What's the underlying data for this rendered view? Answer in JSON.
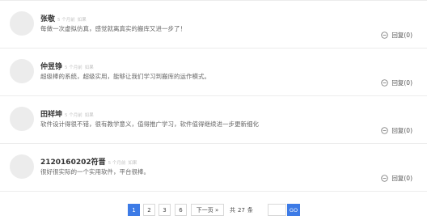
{
  "comments": [
    {
      "name": "张敬",
      "time": "5 个月前",
      "tag": "如果",
      "text": "每做一次虚拟仿真，感觉就离真实的搬库又进一步了！",
      "reply_label": "回复(0)"
    },
    {
      "name": "仲昱铮",
      "time": "5 个月前",
      "tag": "如果",
      "text": "超级棒的系统，超级实用，能够让我们学习到搬库的运作模式。",
      "reply_label": "回复(0)"
    },
    {
      "name": "田祥坤",
      "time": "5 个月前",
      "tag": "如果",
      "text": "软件设计得很不错，很有教学意义，值得推广学习，软件值得继续进一步更新细化",
      "reply_label": "回复(0)"
    },
    {
      "name": "2120160202符晋",
      "time": "5 个月前",
      "tag": "如果",
      "text": "很好很实际的一个实用软件，平台很棒。",
      "reply_label": "回复(0)"
    }
  ],
  "pagination": {
    "pages": [
      "1",
      "2",
      "3",
      "6"
    ],
    "active_page": "1",
    "next_label": "下一页 »",
    "total_prefix": "共",
    "total_count": "27",
    "total_suffix": "条",
    "go_label": "GO"
  },
  "colors": {
    "accent": "#3d7be6",
    "border": "#ececec",
    "avatar": "#ececec"
  }
}
